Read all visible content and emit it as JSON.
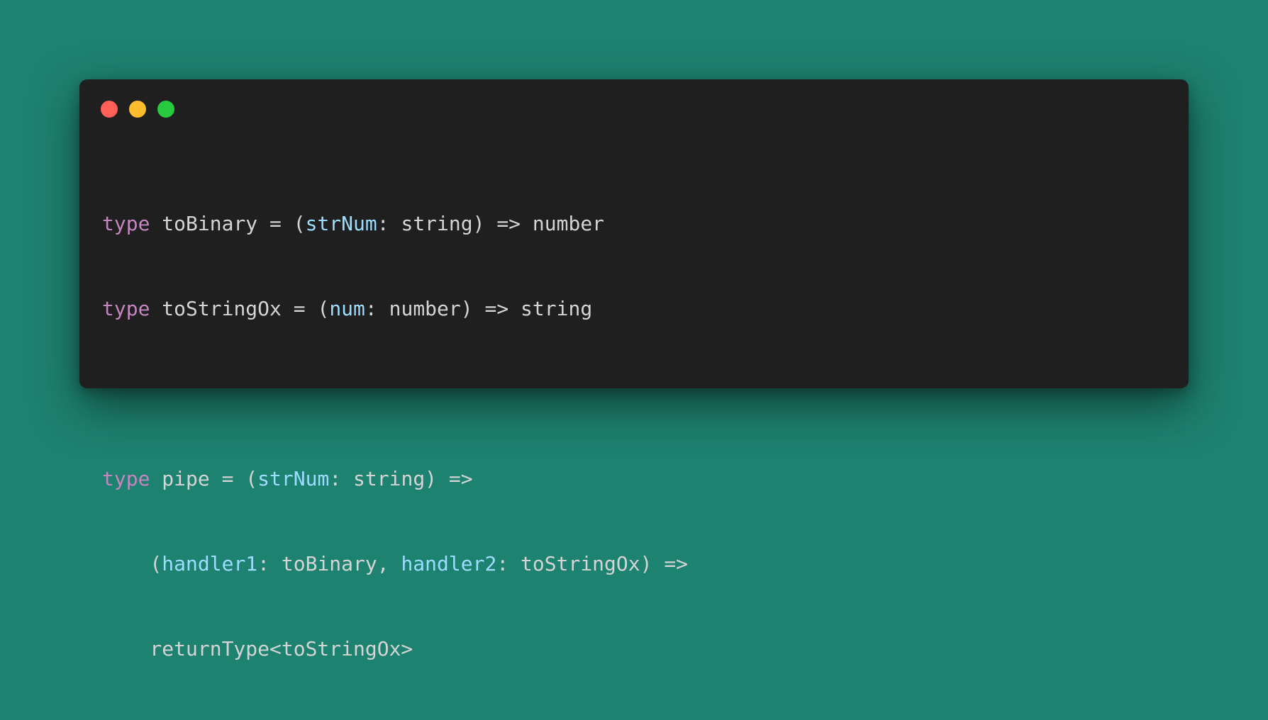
{
  "window": {
    "controls": [
      {
        "name": "close",
        "color": "#ff5f56"
      },
      {
        "name": "minimize",
        "color": "#ffbd2e"
      },
      {
        "name": "maximize",
        "color": "#27c93f"
      }
    ]
  },
  "colors": {
    "background": "#1e8270",
    "window_background": "#1f1f1f",
    "text": "#d4d4d4",
    "keyword": "#c586c0",
    "parameter": "#9cdcfe"
  },
  "code_lines": [
    [
      {
        "text": "type",
        "kind": "keyword"
      },
      {
        "text": " toBinary = (",
        "kind": "plain"
      },
      {
        "text": "strNum",
        "kind": "parameter"
      },
      {
        "text": ": string) => number",
        "kind": "plain"
      }
    ],
    [
      {
        "text": "type",
        "kind": "keyword"
      },
      {
        "text": " toStringOx = (",
        "kind": "plain"
      },
      {
        "text": "num",
        "kind": "parameter"
      },
      {
        "text": ": number) => string",
        "kind": "plain"
      }
    ],
    [],
    [
      {
        "text": "type",
        "kind": "keyword"
      },
      {
        "text": " pipe = (",
        "kind": "plain"
      },
      {
        "text": "strNum",
        "kind": "parameter"
      },
      {
        "text": ": string) =>",
        "kind": "plain"
      }
    ],
    [
      {
        "text": "    (",
        "kind": "plain"
      },
      {
        "text": "handler1",
        "kind": "parameter"
      },
      {
        "text": ": toBinary, ",
        "kind": "plain"
      },
      {
        "text": "handler2",
        "kind": "parameter"
      },
      {
        "text": ": toStringOx) =>",
        "kind": "plain"
      }
    ],
    [
      {
        "text": "    returnType<toStringOx>",
        "kind": "plain"
      }
    ]
  ]
}
